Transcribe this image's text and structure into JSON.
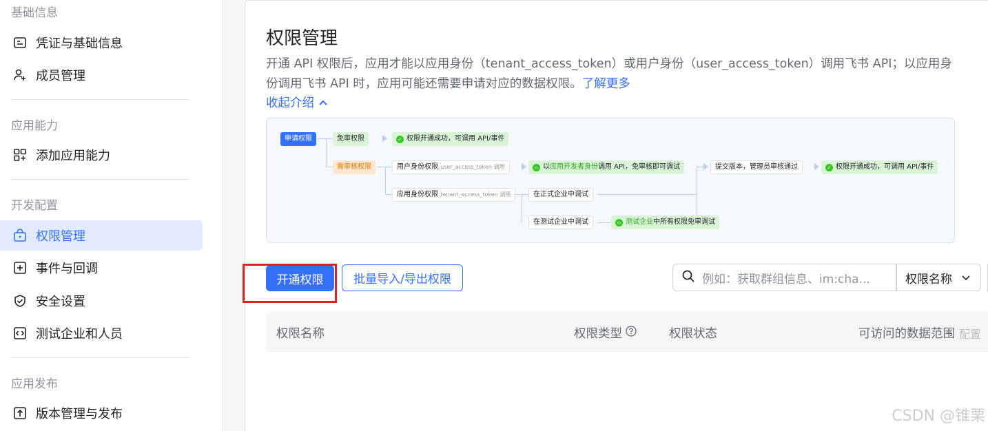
{
  "sidebar": {
    "sections": [
      {
        "heading": "基础信息",
        "items": [
          {
            "label": "凭证与基础信息",
            "icon": "credential-icon"
          },
          {
            "label": "成员管理",
            "icon": "add-member-icon"
          }
        ]
      },
      {
        "heading": "应用能力",
        "items": [
          {
            "label": "添加应用能力",
            "icon": "app-grid-add-icon"
          }
        ]
      },
      {
        "heading": "开发配置",
        "items": [
          {
            "label": "权限管理",
            "icon": "lock-icon",
            "active": true
          },
          {
            "label": "事件与回调",
            "icon": "event-icon"
          },
          {
            "label": "安全设置",
            "icon": "shield-icon"
          },
          {
            "label": "测试企业和人员",
            "icon": "code-icon"
          }
        ]
      },
      {
        "heading": "应用发布",
        "items": [
          {
            "label": "版本管理与发布",
            "icon": "upload-icon"
          }
        ]
      }
    ]
  },
  "main": {
    "title": "权限管理",
    "description": "开通 API 权限后，应用才能以应用身份（tenant_access_token）或用户身份（user_access_token）调用飞书 API；以应用身份调用飞书 API 时，应用可能还需要申请对应的数据权限。",
    "learn_more": "了解更多",
    "collapse_label": "收起介绍",
    "flow": {
      "apply": "申请权限",
      "exempt": "免审权限",
      "exempt_result": "权限开通成功，可调用 API/事件",
      "review": "需审核权限",
      "user_perm": "用户身份权限",
      "user_token": "user_access_token 调用",
      "dev_identity_prefix": "以",
      "dev_identity_hl": "应用开发者身份",
      "dev_identity_suffix": "调用 API，免审核即可调试",
      "submit": "提交版本，管理员审核通过",
      "final_result": "权限开通成功，可调用 API/事件",
      "app_perm": "应用身份权限",
      "app_token": "tenant_access_token 调用",
      "prod_debug": "在正式企业中调试",
      "test_debug": "在测试企业中调试",
      "test_exempt_hl": "测试企业",
      "test_exempt_suffix": "中所有权限免审调试"
    },
    "buttons": {
      "enable": "开通权限",
      "batch": "批量导入/导出权限"
    },
    "search": {
      "placeholder": "例如：获取群组信息、im:cha..."
    },
    "select": {
      "value": "权限名称"
    },
    "table": {
      "columns": [
        "权限名称",
        "权限类型",
        "权限状态",
        "可访问的数据范围"
      ],
      "config_label": "配置"
    }
  },
  "watermark": "CSDN @锥栗",
  "colors": {
    "accent": "#3370ff",
    "active_bg": "#e1eaff",
    "highlight_box": "#e02020"
  }
}
